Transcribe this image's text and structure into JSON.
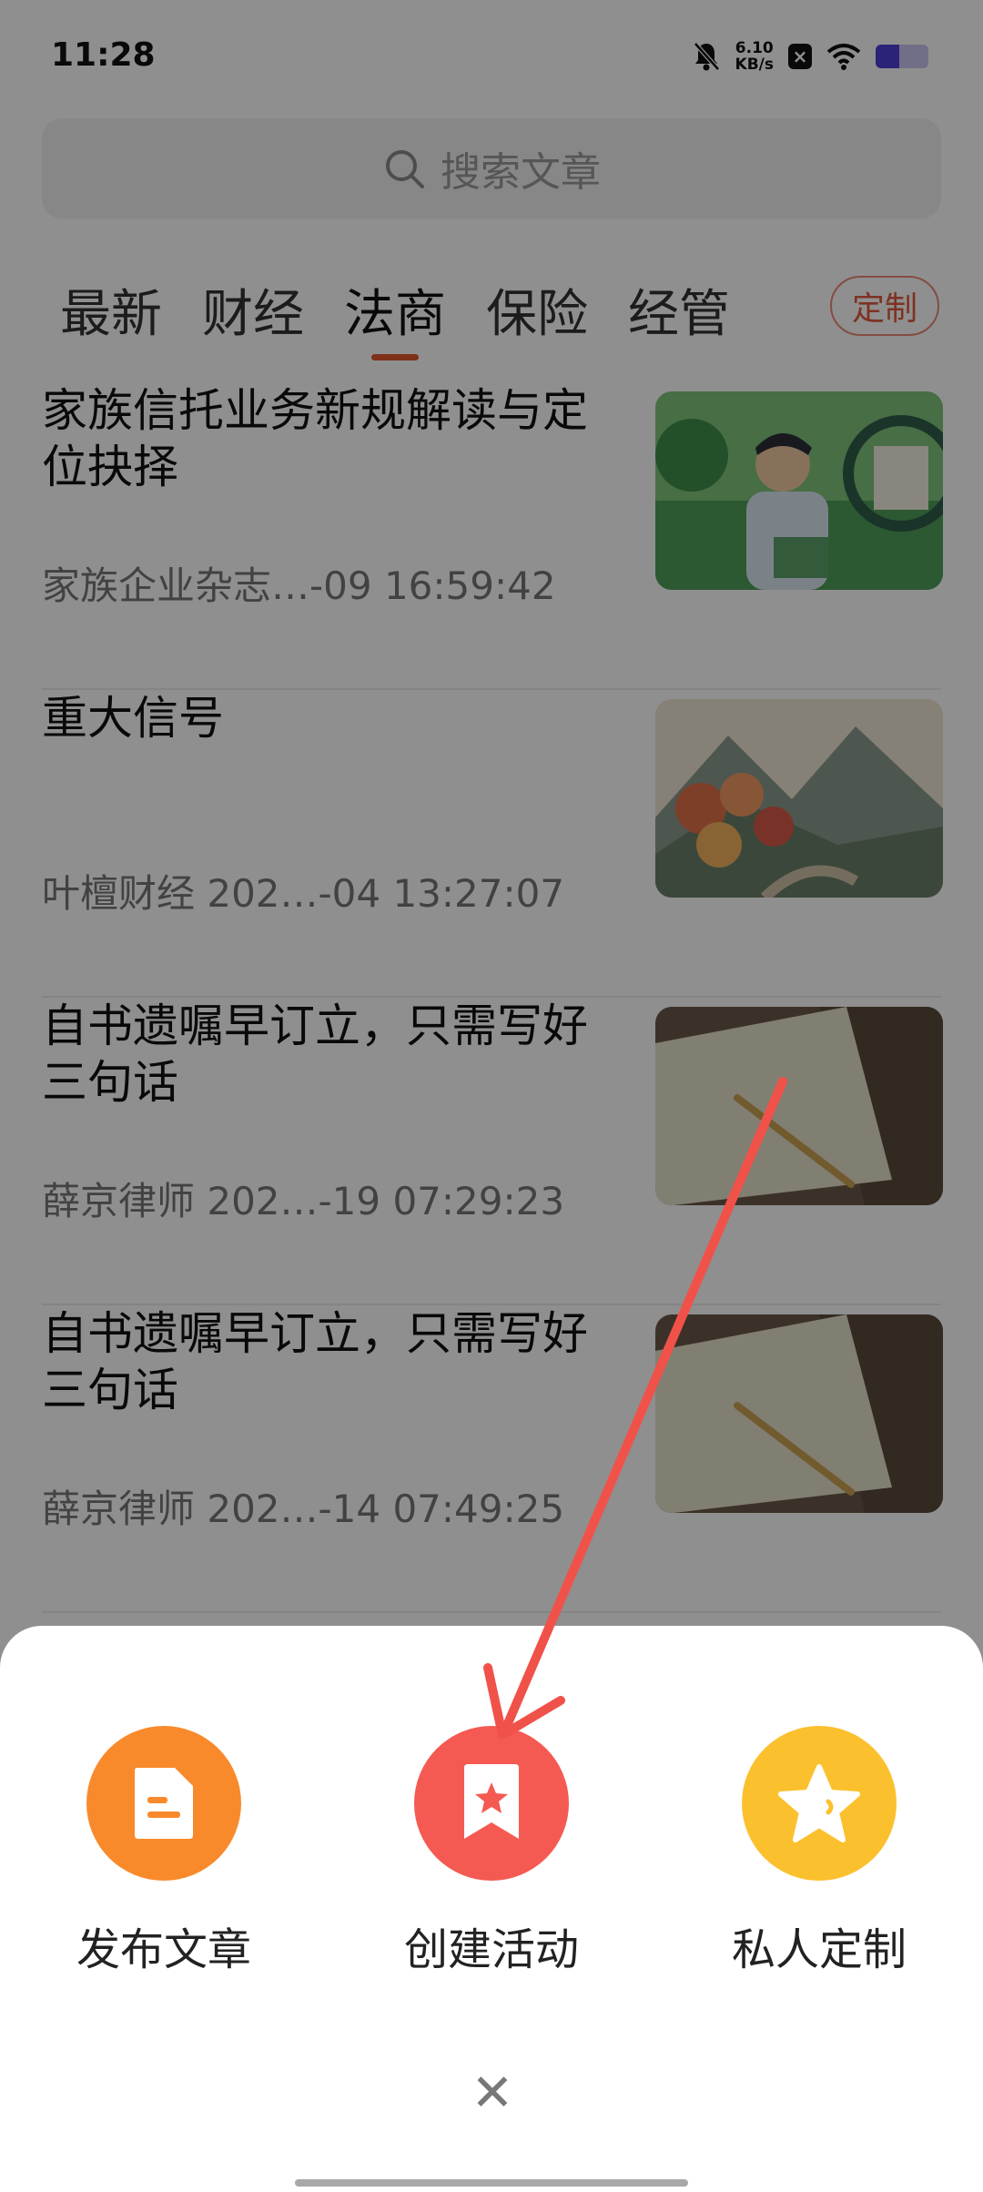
{
  "status_bar": {
    "time": "11:28",
    "net_speed_value": "6.10",
    "net_speed_unit": "KB/s",
    "icons": [
      "bell-mute-icon",
      "x-notification-icon",
      "wifi-icon",
      "battery-icon"
    ]
  },
  "search": {
    "placeholder": "搜索文章"
  },
  "tabs": [
    {
      "label": "最新"
    },
    {
      "label": "财经"
    },
    {
      "label": "法商",
      "active": true
    },
    {
      "label": "保险"
    },
    {
      "label": "经管"
    }
  ],
  "custom_button": "定制",
  "articles": [
    {
      "title": "家族信托业务新规解读与定位抉择",
      "meta": "家族企业杂志…-09 16:59:42",
      "thumb": "illustration-man-magnifier"
    },
    {
      "title": "重大信号",
      "meta": "叶檀财经 202…-04 13:27:07",
      "thumb": "autumn-landscape"
    },
    {
      "title": "自书遗嘱早订立，只需写好三句话",
      "meta": "薛京律师 202…-19 07:29:23",
      "thumb": "notebook-pencil"
    },
    {
      "title": "自书遗嘱早订立，只需写好三句话",
      "meta": "薛京律师 202…-14 07:49:25",
      "thumb": "notebook-pencil"
    }
  ],
  "sheet": {
    "items": [
      {
        "label": "发布文章",
        "icon": "document-icon",
        "color": "#f98a2c"
      },
      {
        "label": "创建活动",
        "icon": "star-bookmark-icon",
        "color": "#f45a52"
      },
      {
        "label": "私人定制",
        "icon": "star-icon",
        "color": "#fbc02d"
      }
    ],
    "close_icon": "close-icon"
  },
  "colors": {
    "accent": "#e2572b",
    "annotation_arrow": "#f0524a"
  }
}
